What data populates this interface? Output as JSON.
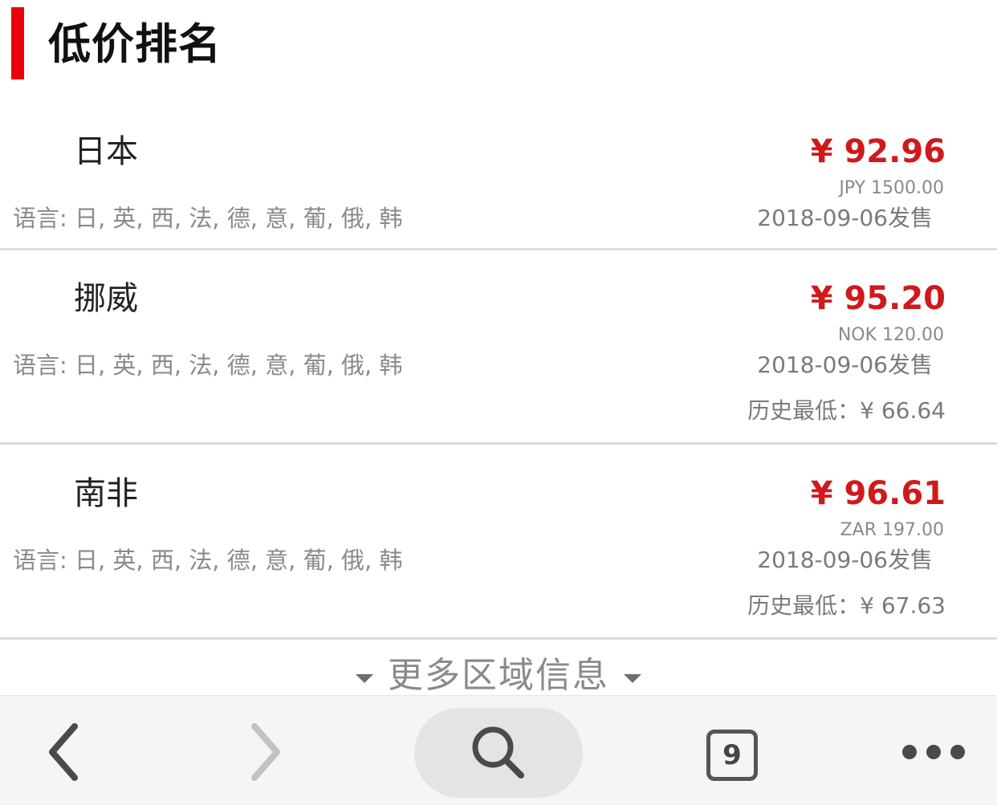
{
  "header": {
    "title": "低价排名"
  },
  "rows": [
    {
      "region": "日本",
      "languages": "语言: 日, 英, 西, 法, 德, 意, 葡, 俄, 韩",
      "price": "¥ 92.96",
      "original": "JPY 1500.00",
      "release": "2018-09-06发售",
      "lowest": ""
    },
    {
      "region": "挪威",
      "languages": "语言: 日, 英, 西, 法, 德, 意, 葡, 俄, 韩",
      "price": "¥ 95.20",
      "original": "NOK 120.00",
      "release": "2018-09-06发售",
      "lowest": "历史最低：¥ 66.64"
    },
    {
      "region": "南非",
      "languages": "语言: 日, 英, 西, 法, 德, 意, 葡, 俄, 韩",
      "price": "¥ 96.61",
      "original": "ZAR 197.00",
      "release": "2018-09-06发售",
      "lowest": "历史最低：¥ 67.63"
    }
  ],
  "more_regions": "更多区域信息",
  "toolbar": {
    "tab_count": "9",
    "icons": [
      "back-arrow-icon",
      "forward-arrow-icon",
      "search-icon",
      "tabs-icon",
      "more-dots-icon"
    ]
  },
  "colors": {
    "accent": "#e8000b",
    "price": "#d0191b"
  }
}
